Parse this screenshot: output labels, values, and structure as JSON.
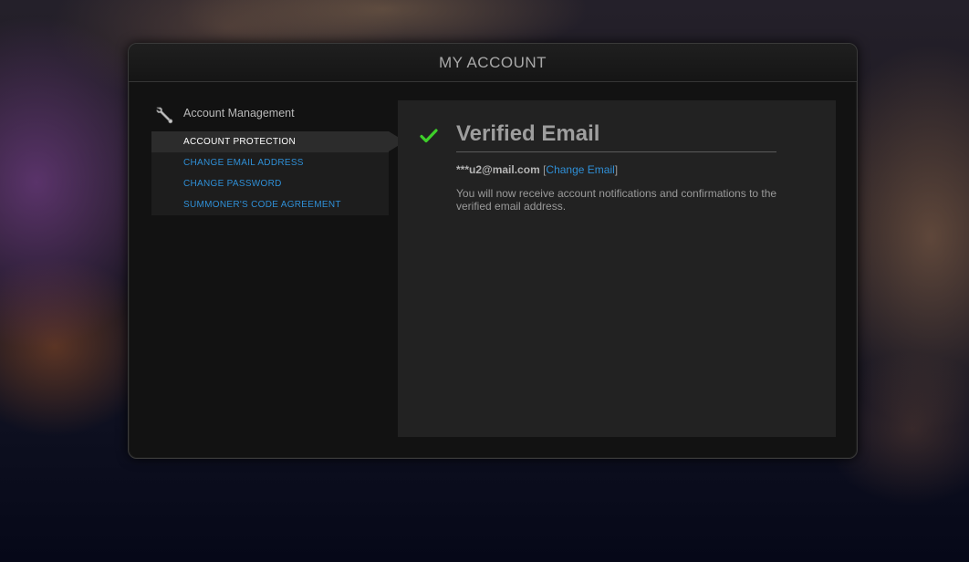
{
  "header": {
    "title": "MY ACCOUNT"
  },
  "sidebar": {
    "heading": "Account Management",
    "heading_icon": "wrench-icon",
    "items": [
      {
        "label": "ACCOUNT PROTECTION",
        "active": true
      },
      {
        "label": "CHANGE EMAIL ADDRESS",
        "active": false
      },
      {
        "label": "CHANGE PASSWORD",
        "active": false
      },
      {
        "label": "SUMMONER'S CODE AGREEMENT",
        "active": false
      }
    ]
  },
  "main": {
    "status_icon": "check-icon",
    "title": "Verified Email",
    "email": "***u2@mail.com",
    "bracket_open": " [",
    "change_email_link": "Change Email",
    "bracket_close": "]",
    "notice": "You will now receive account notifications and confirmations to the verified email address."
  },
  "colors": {
    "accent_link": "#2f8fd6",
    "check_green": "#3ecf2a",
    "panel_bg": "#121212",
    "content_bg": "#222222"
  }
}
